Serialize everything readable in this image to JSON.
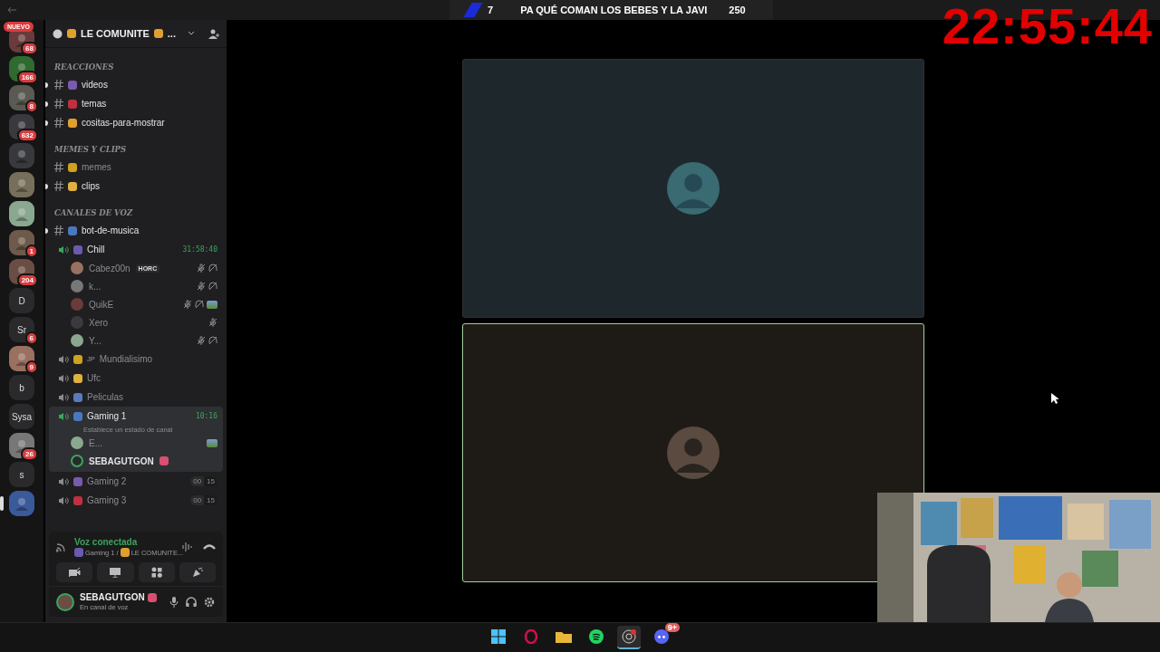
{
  "top_bar": {
    "score": "7",
    "title": "PA QUÉ COMAN LOS BEBES Y LA JAVI",
    "points": "250"
  },
  "clock": "22:55:44",
  "servers": [
    {
      "kind": "avatar",
      "badge": "68",
      "tag": "NUEVO",
      "selected": false
    },
    {
      "kind": "avatar",
      "badge": "166",
      "selected": false
    },
    {
      "kind": "avatar",
      "badge": "8",
      "selected": false
    },
    {
      "kind": "avatar",
      "badge": "632",
      "selected": false
    },
    {
      "kind": "avatar",
      "selected": false
    },
    {
      "kind": "avatar",
      "selected": false
    },
    {
      "kind": "avatar",
      "selected": false
    },
    {
      "kind": "avatar",
      "badge": "1",
      "selected": false
    },
    {
      "kind": "avatar",
      "badge": "204",
      "selected": false
    },
    {
      "kind": "letter",
      "label": "D",
      "selected": false
    },
    {
      "kind": "letter",
      "label": "Sr",
      "badge": "6",
      "selected": false
    },
    {
      "kind": "avatar",
      "badge": "9",
      "selected": false
    },
    {
      "kind": "letter",
      "label": "b",
      "selected": false
    },
    {
      "kind": "letter",
      "label": "Sysa",
      "selected": false
    },
    {
      "kind": "avatar",
      "badge": "26",
      "selected": false
    },
    {
      "kind": "letter",
      "label": "s",
      "selected": false
    },
    {
      "kind": "avatar",
      "selected": true
    }
  ],
  "server_header": {
    "name": "LE COMUNITE",
    "tail": "..."
  },
  "channels": [
    {
      "kind": "category",
      "name": "REACCIONES"
    },
    {
      "kind": "text",
      "name": "videos",
      "unread": true
    },
    {
      "kind": "text",
      "name": "temas",
      "unread": true
    },
    {
      "kind": "text",
      "name": "cositas-para-mostrar",
      "unread": true
    },
    {
      "kind": "category",
      "name": "MEMES Y CLIPS"
    },
    {
      "kind": "text",
      "name": "memes",
      "unread": false
    },
    {
      "kind": "text",
      "name": "clips",
      "unread": true
    },
    {
      "kind": "category",
      "name": "CANALES DE VOZ"
    },
    {
      "kind": "text",
      "name": "bot-de-musica",
      "unread": true
    },
    {
      "kind": "voice",
      "name": "Chill",
      "active": true,
      "selected": false,
      "timer": "31:58:40",
      "members": [
        {
          "name": "Cabez00n",
          "tag": "HORC",
          "muted": true,
          "deafened": true,
          "streaming": false,
          "speaking": false
        },
        {
          "name": "k...",
          "muted": true,
          "deafened": true,
          "streaming": false,
          "speaking": false
        },
        {
          "name": "QuikE",
          "muted": true,
          "deafened": true,
          "streaming": true,
          "speaking": false
        },
        {
          "name": "Xero",
          "muted": true,
          "deafened": false,
          "streaming": false,
          "speaking": false
        },
        {
          "name": "Y...",
          "muted": true,
          "deafened": true,
          "streaming": false,
          "speaking": false
        }
      ]
    },
    {
      "kind": "voice",
      "name": "Mundialisimo",
      "prefix": "JP",
      "active": false,
      "selected": false
    },
    {
      "kind": "voice",
      "name": "Ufc",
      "active": false,
      "selected": false
    },
    {
      "kind": "voice",
      "name": "Peliculas",
      "active": false,
      "selected": false
    },
    {
      "kind": "voice",
      "name": "Gaming 1",
      "active": true,
      "selected": true,
      "timer": "10:16",
      "status": "Establece un estado de canal",
      "members": [
        {
          "name": "E...",
          "muted": false,
          "deafened": false,
          "streaming": true,
          "speaking": false
        },
        {
          "name": "SEBAGUTGON",
          "muted": false,
          "deafened": false,
          "streaming": false,
          "speaking": true
        }
      ]
    },
    {
      "kind": "voice",
      "name": "Gaming 2",
      "active": false,
      "selected": false,
      "count": [
        "00",
        "15"
      ]
    },
    {
      "kind": "voice",
      "name": "Gaming 3",
      "active": false,
      "selected": false,
      "count": [
        "00",
        "15"
      ]
    }
  ],
  "voice_panel": {
    "status": "Voz conectada",
    "channel": "Gaming 1 / ",
    "server": "LE COMUNITE..."
  },
  "user": {
    "name": "SEBAGUTGON",
    "status": "En canal de voz"
  },
  "tiles": [
    {
      "speaking": false
    },
    {
      "speaking": true
    }
  ],
  "taskbar": [
    {
      "kind": "windows",
      "active": false
    },
    {
      "kind": "opera",
      "active": false
    },
    {
      "kind": "folder",
      "active": false
    },
    {
      "kind": "spotify",
      "active": false
    },
    {
      "kind": "obs",
      "active": true
    },
    {
      "kind": "discord",
      "active": false,
      "badge": "9+"
    }
  ]
}
